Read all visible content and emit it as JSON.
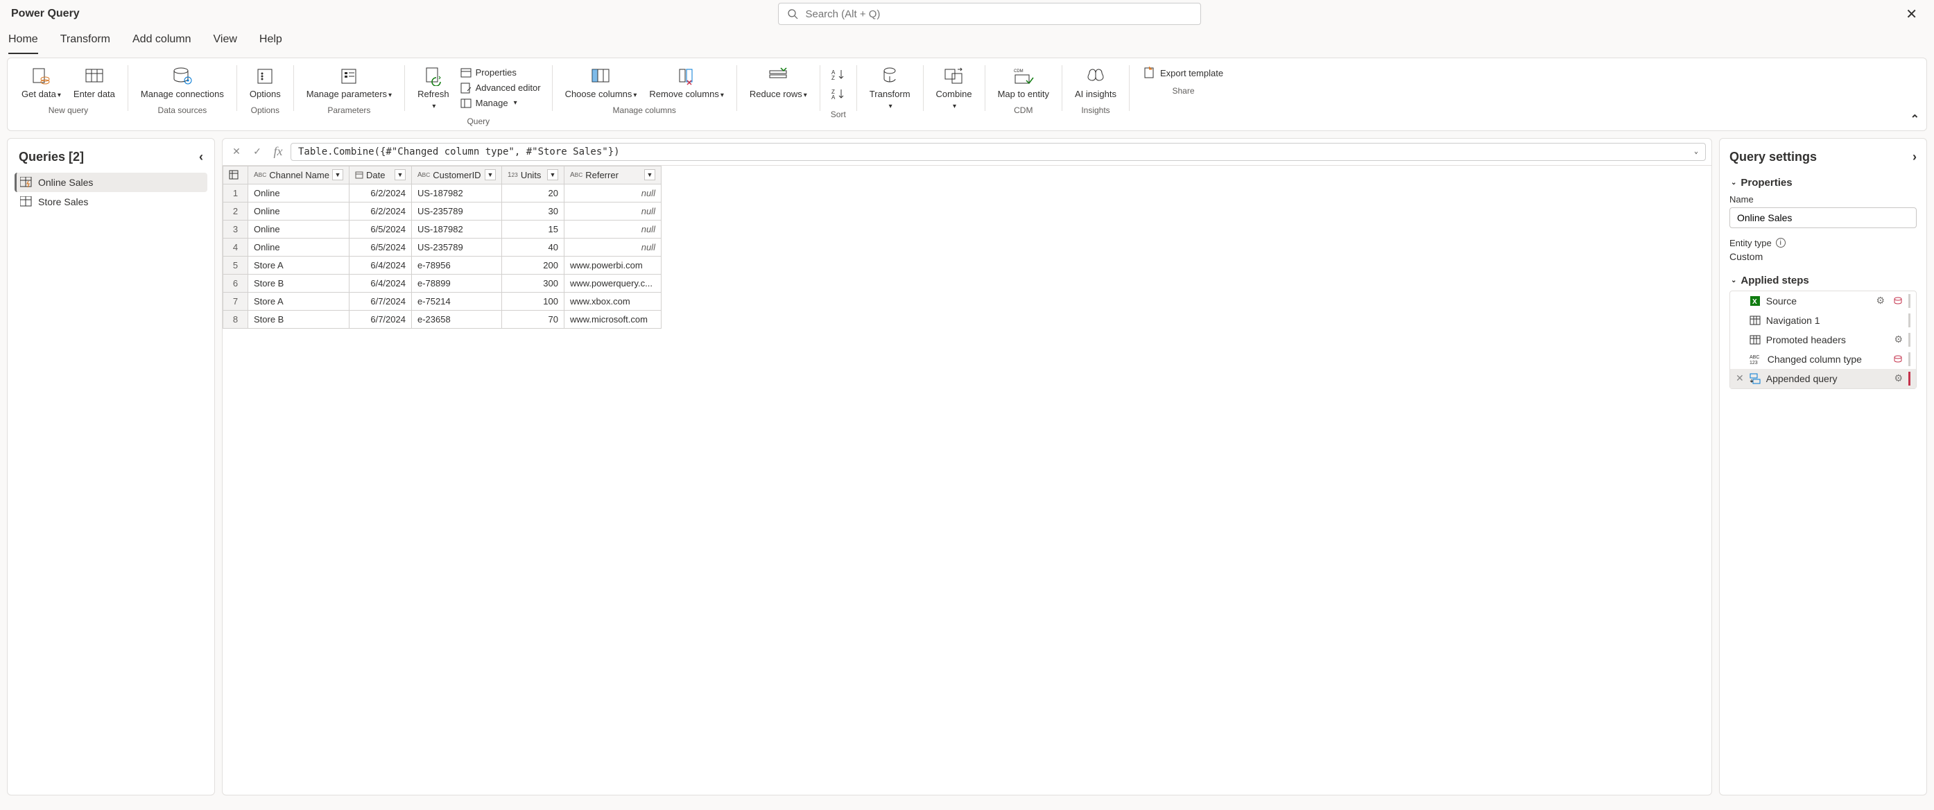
{
  "app_title": "Power Query",
  "search_placeholder": "Search (Alt + Q)",
  "tabs": [
    "Home",
    "Transform",
    "Add column",
    "View",
    "Help"
  ],
  "active_tab": "Home",
  "ribbon": {
    "get_data": "Get data",
    "enter_data": "Enter data",
    "new_query_group": "New query",
    "manage_connections": "Manage connections",
    "data_sources_group": "Data sources",
    "options": "Options",
    "options_group": "Options",
    "manage_parameters": "Manage parameters",
    "parameters_group": "Parameters",
    "refresh": "Refresh",
    "properties": "Properties",
    "advanced_editor": "Advanced editor",
    "manage": "Manage",
    "query_group": "Query",
    "choose_columns": "Choose columns",
    "remove_columns": "Remove columns",
    "manage_columns_group": "Manage columns",
    "reduce_rows": "Reduce rows",
    "sort_group": "Sort",
    "transform": "Transform",
    "combine": "Combine",
    "map_to_entity": "Map to entity",
    "cdm_group": "CDM",
    "ai_insights": "AI insights",
    "insights_group": "Insights",
    "export_template": "Export template",
    "share_group": "Share"
  },
  "queries_panel": {
    "title": "Queries [2]",
    "items": [
      "Online Sales",
      "Store Sales"
    ],
    "active": "Online Sales"
  },
  "formula": "Table.Combine({#\"Changed column type\", #\"Store Sales\"})",
  "columns": [
    {
      "name": "Channel Name",
      "type": "text"
    },
    {
      "name": "Date",
      "type": "date"
    },
    {
      "name": "CustomerID",
      "type": "text"
    },
    {
      "name": "Units",
      "type": "number"
    },
    {
      "name": "Referrer",
      "type": "text"
    }
  ],
  "rows": [
    {
      "n": 1,
      "channel": "Online",
      "date": "6/2/2024",
      "cust": "US-187982",
      "units": "20",
      "ref": null
    },
    {
      "n": 2,
      "channel": "Online",
      "date": "6/2/2024",
      "cust": "US-235789",
      "units": "30",
      "ref": null
    },
    {
      "n": 3,
      "channel": "Online",
      "date": "6/5/2024",
      "cust": "US-187982",
      "units": "15",
      "ref": null
    },
    {
      "n": 4,
      "channel": "Online",
      "date": "6/5/2024",
      "cust": "US-235789",
      "units": "40",
      "ref": null
    },
    {
      "n": 5,
      "channel": "Store A",
      "date": "6/4/2024",
      "cust": "e-78956",
      "units": "200",
      "ref": "www.powerbi.com"
    },
    {
      "n": 6,
      "channel": "Store B",
      "date": "6/4/2024",
      "cust": "e-78899",
      "units": "300",
      "ref": "www.powerquery.c..."
    },
    {
      "n": 7,
      "channel": "Store A",
      "date": "6/7/2024",
      "cust": "e-75214",
      "units": "100",
      "ref": "www.xbox.com"
    },
    {
      "n": 8,
      "channel": "Store B",
      "date": "6/7/2024",
      "cust": "e-23658",
      "units": "70",
      "ref": "www.microsoft.com"
    }
  ],
  "settings": {
    "title": "Query settings",
    "properties_section": "Properties",
    "name_label": "Name",
    "name_value": "Online Sales",
    "entity_type_label": "Entity type",
    "entity_type_value": "Custom",
    "applied_steps_section": "Applied steps",
    "steps": [
      {
        "label": "Source",
        "icon": "excel",
        "gear": true,
        "extra": true
      },
      {
        "label": "Navigation 1",
        "icon": "table",
        "gear": false
      },
      {
        "label": "Promoted headers",
        "icon": "table",
        "gear": true
      },
      {
        "label": "Changed column type",
        "icon": "abc123",
        "gear": false,
        "extra": true
      },
      {
        "label": "Appended query",
        "icon": "append",
        "gear": true,
        "active": true
      }
    ]
  }
}
